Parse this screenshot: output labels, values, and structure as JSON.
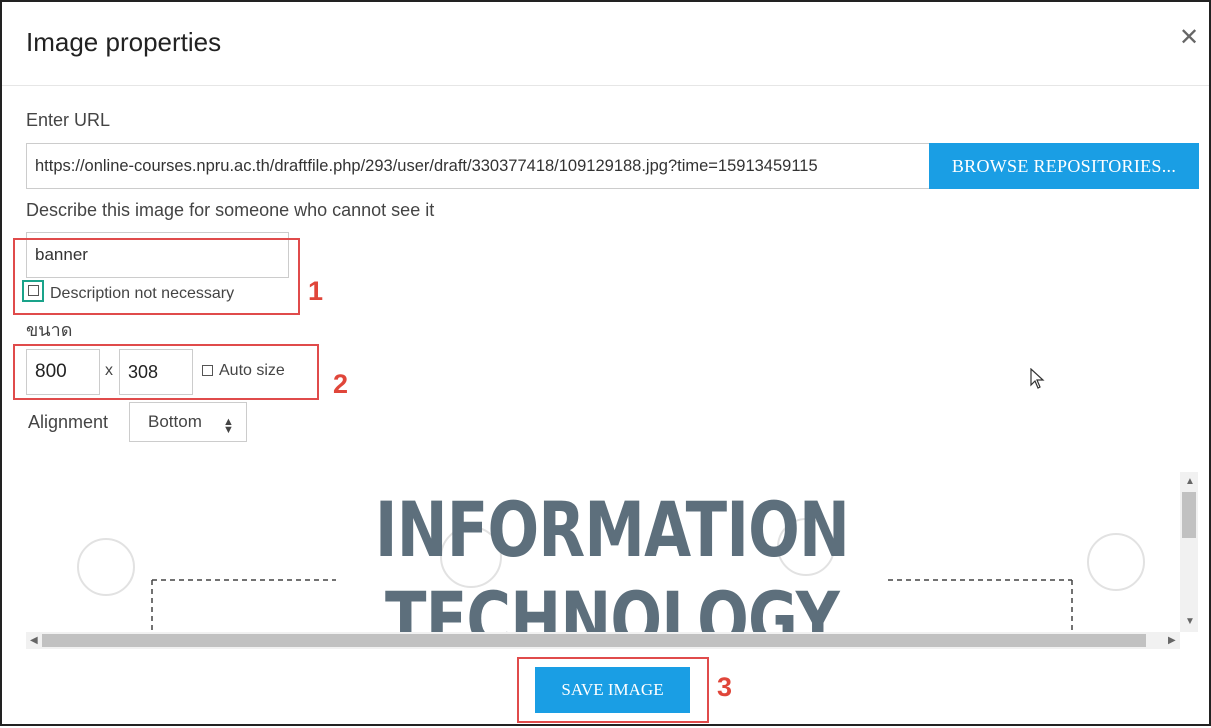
{
  "dialog": {
    "title": "Image properties",
    "close_icon": "close-icon"
  },
  "url": {
    "label": "Enter URL",
    "value": "https://online-courses.npru.ac.th/draftfile.php/293/user/draft/330377418/109129188.jpg?time=15913459115",
    "browse_label": "BROWSE REPOSITORIES..."
  },
  "alt": {
    "label": "Describe this image for someone who cannot see it",
    "value": "banner",
    "not_necessary_label": "Description not necessary"
  },
  "size": {
    "label": "ขนาด",
    "width": "800",
    "separator": "x",
    "height": "308",
    "auto_label": "Auto size"
  },
  "alignment": {
    "label": "Alignment",
    "selected": "Bottom",
    "caret": "♦"
  },
  "preview": {
    "line1": "INFORMATION",
    "line2": "TECHNOLOGY"
  },
  "save_label": "SAVE IMAGE",
  "annotations": [
    "1",
    "2",
    "3"
  ],
  "colors": {
    "accent": "#1a9ee4",
    "highlight_red": "#e04b4b",
    "highlight_green": "#1aa38a",
    "preview_text": "#5d6f7c"
  }
}
